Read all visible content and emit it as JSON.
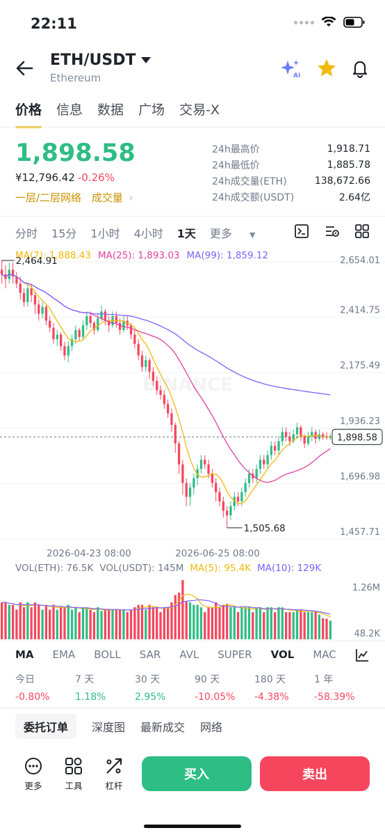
{
  "status": {
    "time": "22:11"
  },
  "header": {
    "pair": "ETH/USDT",
    "subtitle": "Ethereum"
  },
  "tabs": [
    "价格",
    "信息",
    "数据",
    "广场",
    "交易-X"
  ],
  "price": {
    "last": "1,898.58",
    "fiat": "¥12,796.42",
    "change": "-0.26%",
    "layers_label": "一层/二层网络",
    "volume_label": "成交量"
  },
  "stats": [
    {
      "label": "24h最高价",
      "value": "1,918.71"
    },
    {
      "label": "24h最低价",
      "value": "1,885.78"
    },
    {
      "label": "24h成交量(ETH)",
      "value": "138,672.66"
    },
    {
      "label": "24h成交额(USDT)",
      "value": "2.64亿"
    }
  ],
  "timeframes": [
    "分时",
    "15分",
    "1小时",
    "4小时",
    "1天",
    "更多"
  ],
  "active_timeframe": "1天",
  "ma": {
    "ma7": "MA(7): 1,888.43",
    "ma25": "MA(25): 1,893.03",
    "ma99": "MA(99): 1,859.12"
  },
  "chart_data": {
    "type": "candlestick",
    "y_ticks": [
      "2,654.01",
      "2,414.75",
      "2,175.49",
      "1,936.23",
      "1,696.98",
      "1,457.71"
    ],
    "ylim": [
      1457.71,
      2654.01
    ],
    "x_ticks": [
      "2026-04-23 08:00",
      "2026-06-25 08:00"
    ],
    "current_price": "1,898.58",
    "high_label": "2,464.91",
    "low_label": "1,505.68",
    "watermark": "BINANCE",
    "colors": {
      "up": "#2ebd85",
      "down": "#f6465d",
      "ma7": "#f0b90b",
      "ma25": "#e040a0",
      "ma99": "#7b61ff"
    },
    "candles": [
      [
        2620,
        2600,
        2660,
        2560
      ],
      [
        2600,
        2580,
        2640,
        2540
      ],
      [
        2580,
        2620,
        2650,
        2560
      ],
      [
        2620,
        2590,
        2650,
        2560
      ],
      [
        2590,
        2560,
        2610,
        2540
      ],
      [
        2560,
        2520,
        2590,
        2490
      ],
      [
        2520,
        2480,
        2540,
        2460
      ],
      [
        2480,
        2540,
        2560,
        2460
      ],
      [
        2540,
        2510,
        2560,
        2480
      ],
      [
        2510,
        2470,
        2530,
        2430
      ],
      [
        2470,
        2430,
        2490,
        2400
      ],
      [
        2430,
        2460,
        2480,
        2410
      ],
      [
        2460,
        2400,
        2470,
        2380
      ],
      [
        2400,
        2370,
        2420,
        2350
      ],
      [
        2370,
        2320,
        2390,
        2300
      ],
      [
        2320,
        2340,
        2360,
        2290
      ],
      [
        2340,
        2290,
        2350,
        2270
      ],
      [
        2290,
        2250,
        2310,
        2230
      ],
      [
        2250,
        2290,
        2310,
        2220
      ],
      [
        2290,
        2320,
        2340,
        2270
      ],
      [
        2320,
        2360,
        2380,
        2300
      ],
      [
        2360,
        2330,
        2370,
        2310
      ],
      [
        2330,
        2380,
        2400,
        2320
      ],
      [
        2380,
        2420,
        2440,
        2360
      ],
      [
        2420,
        2390,
        2440,
        2370
      ],
      [
        2390,
        2360,
        2400,
        2340
      ],
      [
        2360,
        2410,
        2430,
        2350
      ],
      [
        2410,
        2440,
        2465,
        2400
      ],
      [
        2440,
        2400,
        2450,
        2380
      ],
      [
        2400,
        2380,
        2420,
        2350
      ],
      [
        2380,
        2420,
        2440,
        2370
      ],
      [
        2420,
        2390,
        2440,
        2370
      ],
      [
        2390,
        2360,
        2410,
        2340
      ],
      [
        2360,
        2400,
        2420,
        2350
      ],
      [
        2400,
        2380,
        2420,
        2360
      ],
      [
        2380,
        2340,
        2390,
        2320
      ],
      [
        2340,
        2300,
        2360,
        2280
      ],
      [
        2300,
        2250,
        2320,
        2230
      ],
      [
        2250,
        2200,
        2270,
        2180
      ],
      [
        2200,
        2230,
        2250,
        2180
      ],
      [
        2230,
        2180,
        2240,
        2150
      ],
      [
        2180,
        2140,
        2200,
        2120
      ],
      [
        2140,
        2100,
        2160,
        2080
      ],
      [
        2100,
        2080,
        2120,
        2060
      ],
      [
        2080,
        2040,
        2100,
        2020
      ],
      [
        2040,
        2000,
        2060,
        1980
      ],
      [
        2000,
        1950,
        2020,
        1920
      ],
      [
        1950,
        1870,
        1960,
        1830
      ],
      [
        1870,
        1780,
        1880,
        1740
      ],
      [
        1780,
        1700,
        1800,
        1650
      ],
      [
        1700,
        1640,
        1720,
        1600
      ],
      [
        1640,
        1680,
        1700,
        1600
      ],
      [
        1680,
        1720,
        1740,
        1650
      ],
      [
        1720,
        1760,
        1780,
        1690
      ],
      [
        1760,
        1800,
        1820,
        1740
      ],
      [
        1800,
        1780,
        1820,
        1760
      ],
      [
        1780,
        1740,
        1800,
        1720
      ],
      [
        1740,
        1700,
        1760,
        1680
      ],
      [
        1700,
        1660,
        1720,
        1620
      ],
      [
        1660,
        1620,
        1680,
        1600
      ],
      [
        1620,
        1580,
        1640,
        1550
      ],
      [
        1580,
        1560,
        1600,
        1506
      ],
      [
        1560,
        1600,
        1620,
        1540
      ],
      [
        1600,
        1640,
        1660,
        1580
      ],
      [
        1640,
        1620,
        1660,
        1600
      ],
      [
        1620,
        1660,
        1680,
        1600
      ],
      [
        1660,
        1700,
        1720,
        1640
      ],
      [
        1700,
        1740,
        1760,
        1680
      ],
      [
        1740,
        1720,
        1760,
        1700
      ],
      [
        1720,
        1760,
        1780,
        1700
      ],
      [
        1760,
        1800,
        1820,
        1740
      ],
      [
        1800,
        1780,
        1820,
        1760
      ],
      [
        1780,
        1820,
        1840,
        1760
      ],
      [
        1820,
        1860,
        1880,
        1800
      ],
      [
        1860,
        1840,
        1880,
        1820
      ],
      [
        1840,
        1880,
        1900,
        1820
      ],
      [
        1880,
        1920,
        1940,
        1860
      ],
      [
        1920,
        1900,
        1940,
        1880
      ],
      [
        1900,
        1880,
        1920,
        1860
      ],
      [
        1880,
        1910,
        1930,
        1870
      ],
      [
        1910,
        1940,
        1960,
        1890
      ],
      [
        1940,
        1900,
        1950,
        1880
      ],
      [
        1900,
        1870,
        1910,
        1850
      ],
      [
        1870,
        1900,
        1920,
        1860
      ],
      [
        1900,
        1920,
        1940,
        1880
      ],
      [
        1920,
        1890,
        1930,
        1870
      ],
      [
        1890,
        1910,
        1930,
        1880
      ],
      [
        1910,
        1900,
        1920,
        1885
      ],
      [
        1900,
        1895,
        1919,
        1886
      ],
      [
        1895,
        1899,
        1910,
        1885
      ]
    ]
  },
  "volume": {
    "vol_eth": "VOL(ETH): 76.5K",
    "vol_usdt": "VOL(USDT): 145M",
    "ma5": "MA(5): 95.4K",
    "ma10": "MA(10): 129K",
    "y_ticks": [
      "1.26M",
      "48.2K"
    ]
  },
  "indicators": [
    "MA",
    "EMA",
    "BOLL",
    "SAR",
    "AVL",
    "SUPER",
    "VOL",
    "MAC"
  ],
  "performance": [
    {
      "label": "今日",
      "value": "-0.80%"
    },
    {
      "label": "7 天",
      "value": "1.18%"
    },
    {
      "label": "30 天",
      "value": "2.95%"
    },
    {
      "label": "90 天",
      "value": "-10.05%"
    },
    {
      "label": "180 天",
      "value": "-4.38%"
    },
    {
      "label": "1 年",
      "value": "-58.39%"
    }
  ],
  "bottom_tabs": [
    "委托订单",
    "深度图",
    "最新成交",
    "网络"
  ],
  "actions": {
    "more": "更多",
    "tools": "工具",
    "leverage": "杠杆",
    "buy": "买入",
    "sell": "卖出"
  }
}
